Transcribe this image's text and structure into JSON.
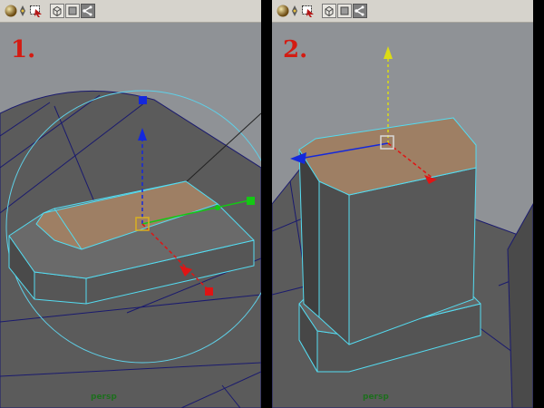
{
  "panels": [
    {
      "step": "1.",
      "camera": "persp"
    },
    {
      "step": "2.",
      "camera": "persp"
    }
  ],
  "toolbar_icons": [
    "sphere-shading-icon",
    "lights-icon",
    "selection-mask-icon",
    "wireframe-cube-icon",
    "smooth-shade-icon",
    "isolate-select-icon"
  ],
  "colors": {
    "viewport_bg": "#8f9296",
    "mesh_face": "#5c5c5c",
    "mesh_edge": "#54dbf0",
    "selected_face": "#9e7f64",
    "grid_line": "#1a1a6e",
    "axis_x": "#e01414",
    "axis_y": "#dcdc14",
    "axis_z": "#1428dc",
    "step_label": "#d41b12",
    "camera_label": "#1e6e1e"
  }
}
